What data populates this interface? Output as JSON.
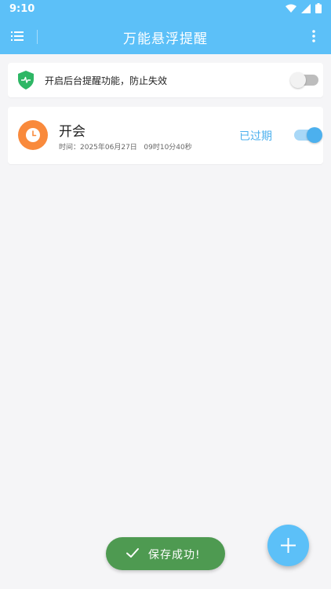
{
  "status_bar": {
    "time": "9:10"
  },
  "app_bar": {
    "title": "万能悬浮提醒"
  },
  "background_card": {
    "text": "开启后台提醒功能，防止失效",
    "enabled": false
  },
  "reminders": [
    {
      "title": "开会",
      "time_text": "时间：2025年06月27日   09时10分40秒",
      "status": "已过期",
      "enabled": true
    }
  ],
  "toast": {
    "text": "保存成功!"
  },
  "colors": {
    "primary": "#5cc0f8",
    "accent": "#4cb0ee",
    "clock": "#f98a3c",
    "shield": "#2eb765",
    "toast": "#4e9a51"
  },
  "icons": {
    "menu": "menu-icon",
    "more": "more-vert-icon",
    "shield": "shield-heartbeat-icon",
    "clock": "clock-icon",
    "check": "check-icon",
    "add": "plus-icon"
  }
}
